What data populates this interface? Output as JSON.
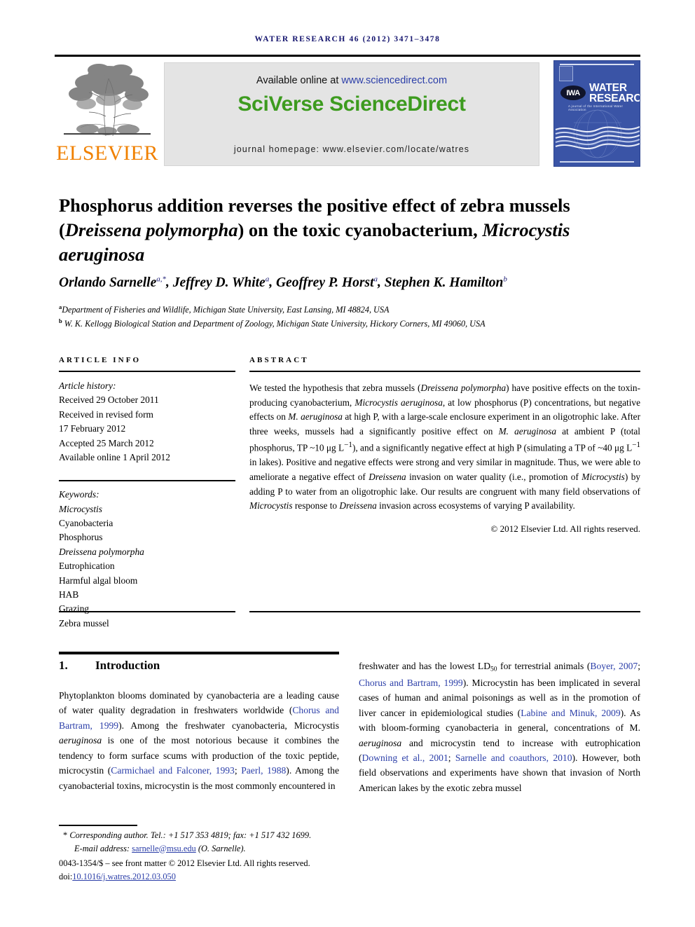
{
  "running_head": {
    "journal": "Water Research",
    "volume_year_pages": "46 (2012) 3471–3478"
  },
  "masthead": {
    "publisher_logo_text": "ELSEVIER",
    "available_prefix": "Available online at ",
    "available_url": "www.sciencedirect.com",
    "platform_brand": "SciVerse ScienceDirect",
    "journal_homepage": "journal homepage: www.elsevier.com/locate/watres",
    "cover": {
      "iwa_logo_text": "IWA",
      "title_line1": "WATER",
      "title_line2": "RESEARCH",
      "subtitle": "A journal of the International Water Association"
    },
    "colors": {
      "brand_green": "#3d9b1f",
      "elsevier_orange": "#f08000",
      "link_blue": "#2b3ea8",
      "cover_blue": "#3a54a6",
      "box_gray": "#e4e4e4",
      "runhead_navy": "#14146e"
    }
  },
  "article": {
    "title_part1": "Phosphorus addition reverses the positive effect of zebra mussels (",
    "title_italic1": "Dreissena polymorpha",
    "title_part2": ") on the toxic cyanobacterium, ",
    "title_italic2": "Microcystis aeruginosa",
    "authors": [
      {
        "name": "Orlando Sarnelle",
        "sup": "a,*"
      },
      {
        "name": "Jeffrey D. White",
        "sup": "a"
      },
      {
        "name": "Geoffrey P. Horst",
        "sup": "a"
      },
      {
        "name": "Stephen K. Hamilton",
        "sup": "b"
      }
    ],
    "affiliations": [
      {
        "mark": "a",
        "text": "Department of Fisheries and Wildlife, Michigan State University, East Lansing, MI 48824, USA"
      },
      {
        "mark": "b",
        "text": "W. K. Kellogg Biological Station and Department of Zoology, Michigan State University, Hickory Corners, MI 49060, USA"
      }
    ]
  },
  "article_info": {
    "heading": "Article info",
    "history_label": "Article history:",
    "history": [
      "Received 29 October 2011",
      "Received in revised form",
      "17 February 2012",
      "Accepted 25 March 2012",
      "Available online 1 April 2012"
    ],
    "keywords_label": "Keywords:",
    "keywords": [
      "Microcystis",
      "Cyanobacteria",
      "Phosphorus",
      "Dreissena polymorpha",
      "Eutrophication",
      "Harmful algal bloom",
      "HAB",
      "Grazing",
      "Zebra mussel"
    ],
    "italic_keywords": [
      "Microcystis",
      "Dreissena polymorpha"
    ]
  },
  "abstract": {
    "heading": "Abstract",
    "segments": [
      {
        "t": "We tested the hypothesis that zebra mussels ("
      },
      {
        "t": "Dreissena polymorpha",
        "i": true
      },
      {
        "t": ") have positive effects on the toxin-producing cyanobacterium, "
      },
      {
        "t": "Microcystis aeruginosa",
        "i": true
      },
      {
        "t": ", at low phosphorus (P) concentrations, but negative effects on "
      },
      {
        "t": "M. aeruginosa",
        "i": true
      },
      {
        "t": " at high P, with a large-scale enclosure experiment in an oligotrophic lake. After three weeks, mussels had a significantly positive effect on "
      },
      {
        "t": "M. aeruginosa",
        "i": true
      },
      {
        "t": " at ambient P (total phosphorus, TP ~10 μg L"
      },
      {
        "t": "−1",
        "sup": true
      },
      {
        "t": "), and a significantly negative effect at high P (simulating a TP of ~40 μg L"
      },
      {
        "t": "−1",
        "sup": true
      },
      {
        "t": " in lakes). Positive and negative effects were strong and very similar in magnitude. Thus, we were able to ameliorate a negative effect of "
      },
      {
        "t": "Dreissena",
        "i": true
      },
      {
        "t": " invasion on water quality (i.e., promotion of "
      },
      {
        "t": "Microcystis",
        "i": true
      },
      {
        "t": ") by adding P to water from an oligotrophic lake. Our results are congruent with many field observations of "
      },
      {
        "t": "Microcystis",
        "i": true
      },
      {
        "t": " response to "
      },
      {
        "t": "Dreissena",
        "i": true
      },
      {
        "t": " invasion across ecosystems of varying P availability."
      }
    ],
    "copyright": "© 2012 Elsevier Ltd. All rights reserved."
  },
  "body": {
    "section_number": "1.",
    "section_title": "Introduction",
    "left_column": [
      {
        "t": "Phytoplankton blooms dominated by cyanobacteria are a leading cause of water quality degradation in freshwaters worldwide ("
      },
      {
        "t": "Chorus and Bartram, 1999",
        "cite": true
      },
      {
        "t": "). Among the freshwater cyanobacteria, "
      },
      {
        "t": "Microcystis",
        "i": false
      },
      {
        "t": " "
      },
      {
        "t": "aeruginosa",
        "i": true
      },
      {
        "t": " is one of the most notorious because it combines the tendency to form surface scums with production of the toxic peptide, microcystin ("
      },
      {
        "t": "Carmichael and Falconer, 1993",
        "cite": true
      },
      {
        "t": "; "
      },
      {
        "t": "Paerl, 1988",
        "cite": true
      },
      {
        "t": "). Among the cyanobacterial toxins, microcystin is the most commonly encountered in"
      }
    ],
    "right_column": [
      {
        "t": "freshwater and has the lowest LD"
      },
      {
        "t": "50",
        "sub": true
      },
      {
        "t": " for terrestrial animals ("
      },
      {
        "t": "Boyer, 2007",
        "cite": true
      },
      {
        "t": "; "
      },
      {
        "t": "Chorus and Bartram, 1999",
        "cite": true
      },
      {
        "t": "). Microcystin has been implicated in several cases of human and animal poisonings as well as in the promotion of liver cancer in epidemiological studies ("
      },
      {
        "t": "Labine and Minuk, 2009",
        "cite": true
      },
      {
        "t": "). As with bloom-forming cyanobacteria in general, concentrations of M. "
      },
      {
        "t": "aeruginosa",
        "i": true
      },
      {
        "t": " and microcystin tend to increase with eutrophication ("
      },
      {
        "t": "Downing et al., 2001",
        "cite": true
      },
      {
        "t": "; "
      },
      {
        "t": "Sarnelle and coauthors, 2010",
        "cite": true
      },
      {
        "t": "). However, both field observations and experiments have shown that invasion of North American lakes by the exotic zebra mussel"
      }
    ]
  },
  "footnote": {
    "corresponding_marker": "*",
    "corresponding_text": "Corresponding author. Tel.: +1 517 353 4819; fax: +1 517 432 1699.",
    "email_label": "E-mail address:",
    "email": "sarnelle@msu.edu",
    "email_owner": "(O. Sarnelle).",
    "issn_line": "0043-1354/$ – see front matter © 2012 Elsevier Ltd. All rights reserved.",
    "doi_prefix": "doi:",
    "doi": "10.1016/j.watres.2012.03.050"
  }
}
